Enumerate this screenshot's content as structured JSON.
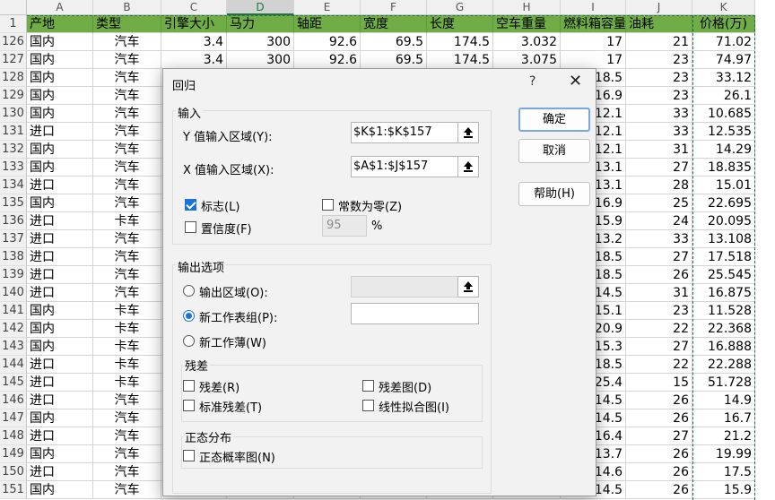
{
  "sheet": {
    "columns": [
      "A",
      "B",
      "C",
      "D",
      "E",
      "F",
      "G",
      "H",
      "I",
      "J",
      "K"
    ],
    "selected_column": "D",
    "header_row_number": "1",
    "headers": [
      "产地",
      "类型",
      "引擎大小",
      "马力",
      "轴距",
      "宽度",
      "长度",
      "空车重量",
      "燃料箱容量",
      "油耗",
      "价格(万)"
    ],
    "rows": [
      {
        "n": "126",
        "a": "国内",
        "b": "汽车",
        "c": "3.4",
        "d": "300",
        "e": "92.6",
        "f": "69.5",
        "g": "174.5",
        "h": "3.032",
        "i": "17",
        "j": "21",
        "k": "71.02"
      },
      {
        "n": "127",
        "a": "国内",
        "b": "汽车",
        "c": "3.4",
        "d": "300",
        "e": "92.6",
        "f": "69.5",
        "g": "174.5",
        "h": "3.075",
        "i": "17",
        "j": "23",
        "k": "74.97"
      },
      {
        "n": "128",
        "a": "国内",
        "b": "汽车",
        "c": "",
        "d": "",
        "e": "",
        "f": "",
        "g": "",
        "h": "",
        "i": "18.5",
        "j": "23",
        "k": "33.12"
      },
      {
        "n": "129",
        "a": "国内",
        "b": "汽车",
        "c": "",
        "d": "",
        "e": "",
        "f": "",
        "g": "",
        "h": "",
        "i": "16.9",
        "j": "23",
        "k": "26.1"
      },
      {
        "n": "130",
        "a": "国内",
        "b": "汽车",
        "c": "",
        "d": "",
        "e": "",
        "f": "",
        "g": "",
        "h": "",
        "i": "12.1",
        "j": "33",
        "k": "10.685"
      },
      {
        "n": "131",
        "a": "进口",
        "b": "汽车",
        "c": "",
        "d": "",
        "e": "",
        "f": "",
        "g": "",
        "h": "",
        "i": "12.1",
        "j": "33",
        "k": "12.535"
      },
      {
        "n": "132",
        "a": "国内",
        "b": "汽车",
        "c": "",
        "d": "",
        "e": "",
        "f": "",
        "g": "",
        "h": "",
        "i": "12.1",
        "j": "31",
        "k": "14.29"
      },
      {
        "n": "133",
        "a": "国内",
        "b": "汽车",
        "c": "",
        "d": "",
        "e": "",
        "f": "",
        "g": "",
        "h": "",
        "i": "13.1",
        "j": "27",
        "k": "18.835"
      },
      {
        "n": "134",
        "a": "进口",
        "b": "汽车",
        "c": "",
        "d": "",
        "e": "",
        "f": "",
        "g": "",
        "h": "",
        "i": "13.1",
        "j": "28",
        "k": "15.01"
      },
      {
        "n": "135",
        "a": "国内",
        "b": "汽车",
        "c": "",
        "d": "",
        "e": "",
        "f": "",
        "g": "",
        "h": "",
        "i": "16.9",
        "j": "25",
        "k": "22.695"
      },
      {
        "n": "136",
        "a": "进口",
        "b": "卡车",
        "c": "",
        "d": "",
        "e": "",
        "f": "",
        "g": "",
        "h": "",
        "i": "15.9",
        "j": "24",
        "k": "20.095"
      },
      {
        "n": "137",
        "a": "进口",
        "b": "汽车",
        "c": "",
        "d": "",
        "e": "",
        "f": "",
        "g": "",
        "h": "",
        "i": "13.2",
        "j": "33",
        "k": "13.108"
      },
      {
        "n": "138",
        "a": "进口",
        "b": "汽车",
        "c": "",
        "d": "",
        "e": "",
        "f": "",
        "g": "",
        "h": "",
        "i": "18.5",
        "j": "27",
        "k": "17.518"
      },
      {
        "n": "139",
        "a": "进口",
        "b": "汽车",
        "c": "",
        "d": "",
        "e": "",
        "f": "",
        "g": "",
        "h": "",
        "i": "18.5",
        "j": "26",
        "k": "25.545"
      },
      {
        "n": "140",
        "a": "进口",
        "b": "汽车",
        "c": "",
        "d": "",
        "e": "",
        "f": "",
        "g": "",
        "h": "",
        "i": "14.5",
        "j": "31",
        "k": "16.875"
      },
      {
        "n": "141",
        "a": "国内",
        "b": "卡车",
        "c": "",
        "d": "",
        "e": "",
        "f": "",
        "g": "",
        "h": "",
        "i": "15.1",
        "j": "23",
        "k": "11.528"
      },
      {
        "n": "142",
        "a": "国内",
        "b": "卡车",
        "c": "",
        "d": "",
        "e": "",
        "f": "",
        "g": "",
        "h": "",
        "i": "20.9",
        "j": "22",
        "k": "22.368"
      },
      {
        "n": "143",
        "a": "国内",
        "b": "卡车",
        "c": "",
        "d": "",
        "e": "",
        "f": "",
        "g": "",
        "h": "",
        "i": "15.3",
        "j": "27",
        "k": "16.888"
      },
      {
        "n": "144",
        "a": "进口",
        "b": "卡车",
        "c": "",
        "d": "",
        "e": "",
        "f": "",
        "g": "",
        "h": "",
        "i": "18.5",
        "j": "22",
        "k": "22.288"
      },
      {
        "n": "145",
        "a": "进口",
        "b": "卡车",
        "c": "",
        "d": "",
        "e": "",
        "f": "",
        "g": "",
        "h": "",
        "i": "25.4",
        "j": "15",
        "k": "51.728"
      },
      {
        "n": "146",
        "a": "进口",
        "b": "汽车",
        "c": "",
        "d": "",
        "e": "",
        "f": "",
        "g": "",
        "h": "",
        "i": "14.5",
        "j": "26",
        "k": "14.9"
      },
      {
        "n": "147",
        "a": "国内",
        "b": "汽车",
        "c": "",
        "d": "",
        "e": "",
        "f": "",
        "g": "",
        "h": "",
        "i": "14.5",
        "j": "26",
        "k": "16.7"
      },
      {
        "n": "148",
        "a": "进口",
        "b": "汽车",
        "c": "",
        "d": "",
        "e": "",
        "f": "",
        "g": "",
        "h": "",
        "i": "16.4",
        "j": "27",
        "k": "21.2"
      },
      {
        "n": "149",
        "a": "国内",
        "b": "汽车",
        "c": "",
        "d": "",
        "e": "",
        "f": "",
        "g": "",
        "h": "",
        "i": "13.7",
        "j": "26",
        "k": "19.99"
      },
      {
        "n": "150",
        "a": "进口",
        "b": "汽车",
        "c": "",
        "d": "",
        "e": "",
        "f": "",
        "g": "",
        "h": "",
        "i": "14.6",
        "j": "26",
        "k": "17.5"
      },
      {
        "n": "151",
        "a": "国内",
        "b": "汽车",
        "c": "",
        "d": "",
        "e": "",
        "f": "",
        "g": "",
        "h": "",
        "i": "14.5",
        "j": "26",
        "k": "15.9"
      }
    ]
  },
  "dialog": {
    "title": "回归",
    "help_icon": "?",
    "close_icon": "✕",
    "input_group": {
      "title": "输入",
      "y_label": "Y 值输入区域(Y):",
      "y_value": "$K$1:$K$157",
      "x_label": "X 值输入区域(X):",
      "x_value": "$A$1:$J$157",
      "labels_checkbox": "标志(L)",
      "labels_checked": true,
      "constant_zero_checkbox": "常数为零(Z)",
      "constant_zero_checked": false,
      "confidence_checkbox": "置信度(F)",
      "confidence_checked": false,
      "confidence_value": "95",
      "percent_sign": "%"
    },
    "output_group": {
      "title": "输出选项",
      "output_range_radio": "输出区域(O):",
      "new_worksheet_radio": "新工作表组(P):",
      "new_workbook_radio": "新工作薄(W)",
      "selected": "new_worksheet"
    },
    "residuals_group": {
      "title": "残差",
      "residuals": "残差(R)",
      "residual_plots": "残差图(D)",
      "standardized_residuals": "标准残差(T)",
      "line_fit_plots": "线性拟合图(I)"
    },
    "normal_group": {
      "title": "正态分布",
      "normal_probability_plots": "正态概率图(N)"
    },
    "buttons": {
      "ok": "确定",
      "cancel": "取消",
      "help": "帮助(H)"
    }
  }
}
